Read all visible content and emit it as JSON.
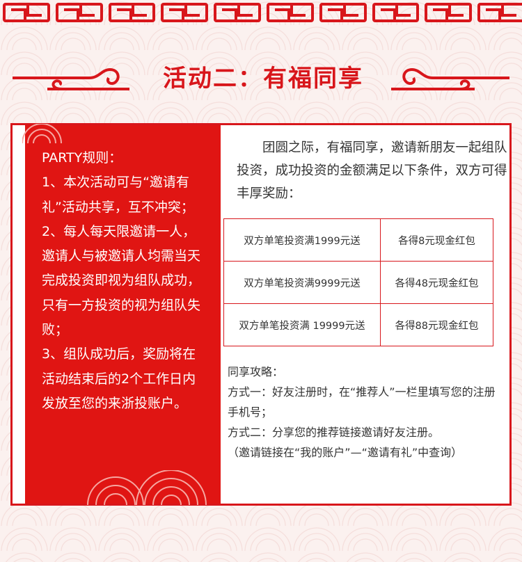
{
  "title": "活动二：有福同享",
  "rules": {
    "heading": "PARTY规则：",
    "items": [
      "1、本次活动可与“邀请有礼”活动共享，互不冲突；",
      "2、每人每天限邀请一人，邀请人与被邀请人均需当天完成投资即视为组队成功，只有一方投资的视为组队失败；",
      "3、组队成功后，奖励将在活动结束后的2个工作日内发放至您的来浙投账户。"
    ]
  },
  "intro": "团圆之际，有福同享，邀请新朋友一起组队投资，成功投资的金额满足以下条件，双方可得丰厚奖励：",
  "conditions": [
    {
      "condition": "双方单笔投资满1999元送",
      "reward": "各得8元现金红包"
    },
    {
      "condition": "双方单笔投资满9999元送",
      "reward": "各得48元现金红包"
    },
    {
      "condition": "双方单笔投资满 19999元送",
      "reward": "各得88元现金红包"
    }
  ],
  "strategy": {
    "heading": "同享攻略：",
    "lines": [
      "方式一：好友注册时，在“推荐人”一栏里填写您的注册手机号；",
      "方式二：分享您的推荐链接邀请好友注册。",
      "（邀请链接在“我的账户”—“邀请有礼”中查询）"
    ]
  },
  "colors": {
    "accent": "#d8161b",
    "panel_red": "#e01513",
    "background": "#fbf1ef"
  }
}
